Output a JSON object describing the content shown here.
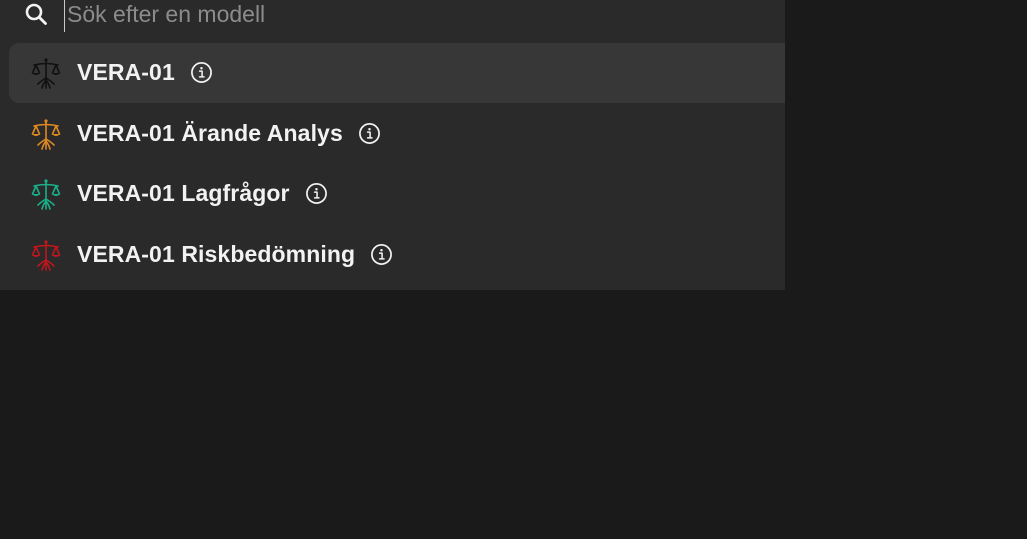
{
  "search": {
    "placeholder": "Sök efter en modell",
    "value": "",
    "icon": "search-icon"
  },
  "models": [
    {
      "label": "VERA-01",
      "color": "#111111",
      "selected": true,
      "icon": "scales-icon",
      "info_icon": "info-icon"
    },
    {
      "label": "VERA-01 Ärande Analys",
      "color": "#e08a22",
      "selected": false,
      "icon": "scales-icon",
      "info_icon": "info-icon"
    },
    {
      "label": "VERA-01 Lagfrågor",
      "color": "#19b08a",
      "selected": false,
      "icon": "scales-icon",
      "info_icon": "info-icon"
    },
    {
      "label": "VERA-01 Riskbedömning",
      "color": "#c0161c",
      "selected": false,
      "icon": "scales-icon",
      "info_icon": "info-icon"
    }
  ],
  "colors": {
    "background": "#1a1a1a",
    "panel": "#2a2a2a",
    "selected_row": "#373737",
    "text": "#f2f2f2",
    "placeholder": "#8c8c8c"
  }
}
